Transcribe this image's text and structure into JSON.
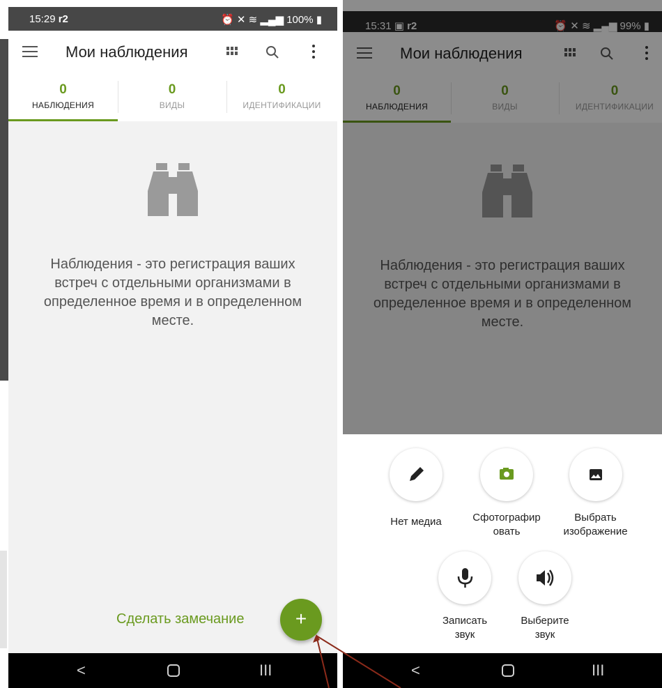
{
  "left_phone": {
    "status": {
      "time": "15:29",
      "carrier_mark": "r2",
      "battery": "100%"
    },
    "appbar": {
      "title": "Мои наблюдения"
    },
    "tabs": [
      {
        "count": "0",
        "label": "НАБЛЮДЕНИЯ",
        "active": true
      },
      {
        "count": "0",
        "label": "ВИДЫ",
        "active": false
      },
      {
        "count": "0",
        "label": "ИДЕНТИФИКАЦИИ",
        "active": false
      }
    ],
    "empty_text": "Наблюдения - это регистрация ваших встреч с отдельными организмами в определенное время и в определенном месте.",
    "fab": {
      "label": "Сделать замечание",
      "icon": "+"
    }
  },
  "right_phone": {
    "status": {
      "time": "15:31",
      "carrier_mark": "r2",
      "battery": "99%"
    },
    "appbar": {
      "title": "Мои наблюдения"
    },
    "tabs": [
      {
        "count": "0",
        "label": "НАБЛЮДЕНИЯ",
        "active": true
      },
      {
        "count": "0",
        "label": "ВИДЫ",
        "active": false
      },
      {
        "count": "0",
        "label": "ИДЕНТИФИКАЦИИ",
        "active": false
      }
    ],
    "empty_text": "Наблюдения - это регистрация ваших встреч с отдельными организмами в определенное время и в определенном месте.",
    "actions": [
      {
        "icon": "pencil-icon",
        "label": "Нет медиа"
      },
      {
        "icon": "camera-icon",
        "label": "Сфотографир\nовать"
      },
      {
        "icon": "image-icon",
        "label": "Выбрать\nизображение"
      },
      {
        "icon": "microphone-icon",
        "label": "Записать\nзвук"
      },
      {
        "icon": "speaker-icon",
        "label": "Выберите\nзвук"
      }
    ]
  },
  "colors": {
    "accent": "#6a9a1f",
    "status_bar": "#474747",
    "nav_bar": "#000000",
    "annotation_arrow": "#8b2a1a"
  }
}
